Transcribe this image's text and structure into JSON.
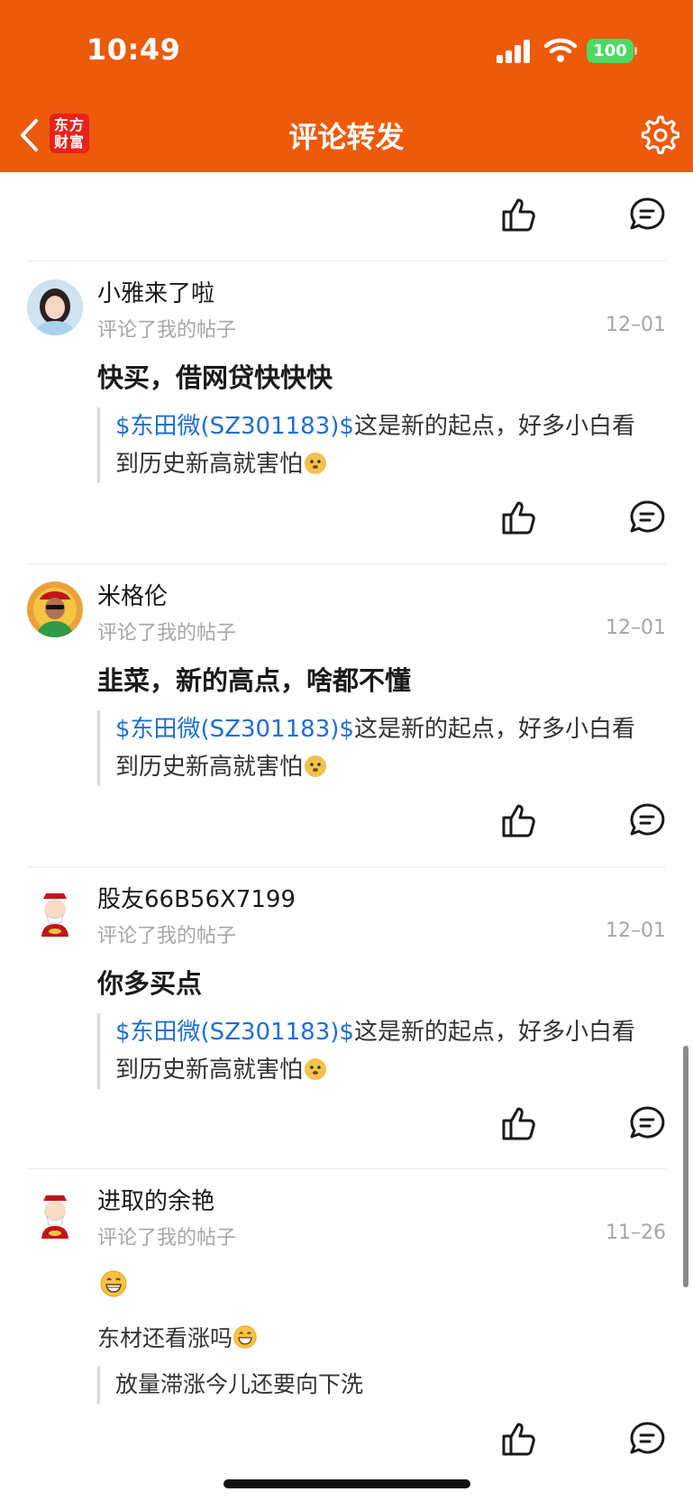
{
  "status_bar": {
    "time": "10:49",
    "battery": "100"
  },
  "nav": {
    "logo_text": "东方财富",
    "title": "评论转发"
  },
  "posts": [
    {
      "username": "小雅来了啦",
      "action": "评论了我的帖子",
      "date": "12–01",
      "comment": "快买，借网贷快快快",
      "quote_link": "$东田微(SZ301183)$",
      "quote_text": "这是新的起点，好多小白看到历史新高就害怕",
      "avatar": "girl-photo-avatar"
    },
    {
      "username": "米格伦",
      "action": "评论了我的帖子",
      "date": "12–01",
      "comment": "韭菜，新的高点，啥都不懂",
      "quote_link": "$东田微(SZ301183)$",
      "quote_text": "这是新的起点，好多小白看到历史新高就害怕",
      "avatar": "caishen-red-avatar"
    },
    {
      "username": "股友66B56X7199",
      "action": "评论了我的帖子",
      "date": "12–01",
      "comment": "你多买点",
      "quote_link": "$东田微(SZ301183)$",
      "quote_text": "这是新的起点，好多小白看到历史新高就害怕",
      "avatar": "caishen-cartoon-avatar"
    },
    {
      "username": "进取的余艳",
      "action": "评论了我的帖子",
      "date": "11–26",
      "comment_line2": "东材还看涨吗",
      "quote_text": "放量滞涨今儿还要向下洗",
      "avatar": "caishen-cartoon-avatar"
    }
  ],
  "colors": {
    "header": "#ec5a0a",
    "link": "#1f6fd1",
    "battery": "#4cd964"
  }
}
